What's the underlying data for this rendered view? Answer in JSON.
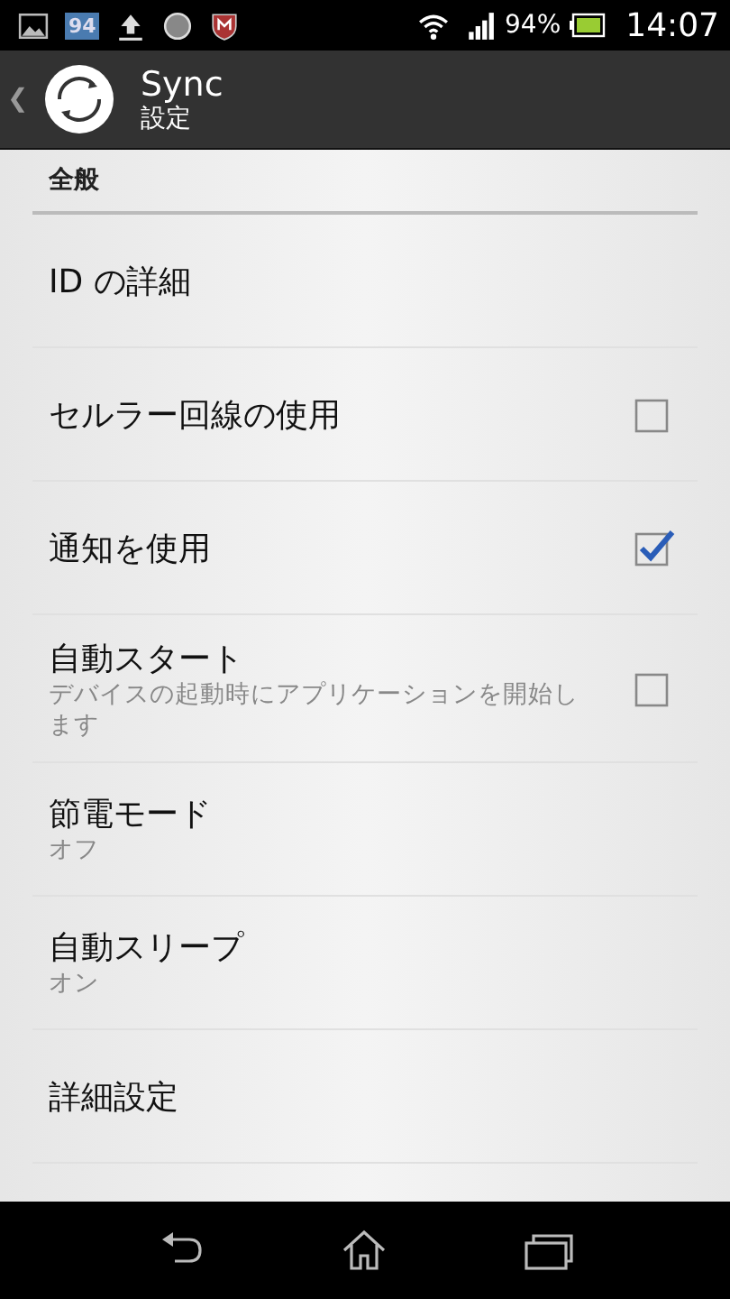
{
  "status_bar": {
    "badge": "94",
    "battery": "94%",
    "time": "14:07"
  },
  "action_bar": {
    "back": "❮",
    "title": "Sync",
    "subtitle": "設定"
  },
  "section": {
    "title": "全般"
  },
  "items": [
    {
      "kind": "plain",
      "title": "ID の詳細"
    },
    {
      "kind": "checkbox",
      "title": "セルラー回線の使用",
      "checked": false
    },
    {
      "kind": "checkbox",
      "title": "通知を使用",
      "checked": true
    },
    {
      "kind": "checkbox",
      "title": "自動スタート",
      "summary": "デバイスの起動時にアプリケーションを開始します",
      "checked": false
    },
    {
      "kind": "plain",
      "title": "節電モード",
      "summary": "オフ"
    },
    {
      "kind": "plain",
      "title": "自動スリープ",
      "summary": "オン"
    },
    {
      "kind": "plain",
      "title": "詳細設定"
    }
  ]
}
